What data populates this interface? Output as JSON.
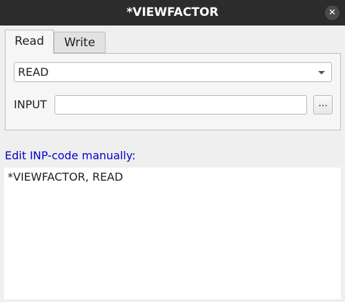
{
  "window": {
    "title": "*VIEWFACTOR",
    "close_label": "✕"
  },
  "tabs": [
    {
      "label": "Read",
      "active": true
    },
    {
      "label": "Write",
      "active": false
    }
  ],
  "read_panel": {
    "combo_value": "READ",
    "input_label": "INPUT",
    "input_value": "",
    "browse_label": "..."
  },
  "editor": {
    "label": "Edit INP-code manually:",
    "code": "*VIEWFACTOR, READ"
  },
  "colors": {
    "titlebar": "#2c2c2c",
    "label_accent": "#0000cc"
  }
}
